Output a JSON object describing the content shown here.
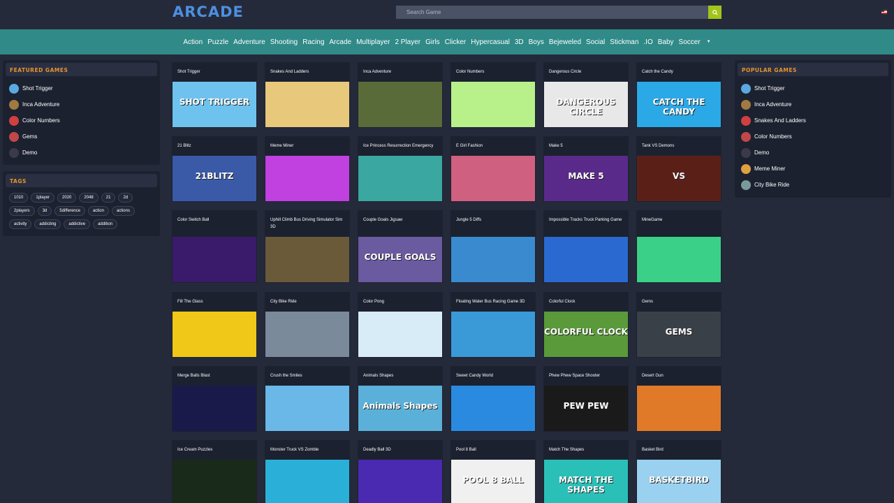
{
  "header": {
    "logo": "ARCADE",
    "search_placeholder": "Search Game"
  },
  "nav": {
    "items": [
      "Action",
      "Puzzle",
      "Adventure",
      "Shooting",
      "Racing",
      "Arcade",
      "Multiplayer",
      "2 Player",
      "Girls",
      "Clicker",
      "Hypercasual",
      "3D",
      "Boys",
      "Bejeweled",
      "Social",
      "Stickman",
      ".IO",
      "Baby",
      "Soccer"
    ]
  },
  "featured": {
    "title": "FEATURED GAMES",
    "items": [
      "Shot Trigger",
      "Inca Adventure",
      "Color Numbers",
      "Gems",
      "Demo"
    ]
  },
  "tags": {
    "title": "TAGS",
    "items": [
      "1010",
      "1player",
      "2020",
      "2048",
      "21",
      "2d",
      "2players",
      "3d",
      "5difference",
      "action",
      "actions",
      "activity",
      "addicting",
      "addictive",
      "addition"
    ]
  },
  "popular": {
    "title": "POPULAR GAMES",
    "items": [
      "Shot Trigger",
      "Inca Adventure",
      "Snakes And Ladders",
      "Color Numbers",
      "Demo",
      "Meme Miner",
      "City Bike Ride"
    ]
  },
  "games": [
    {
      "title": "Shot Trigger",
      "thumb_text": "SHOT TRIGGER",
      "bg": "#6ec3ee"
    },
    {
      "title": "Snakes And Ladders",
      "thumb_text": "",
      "bg": "#e8c87a"
    },
    {
      "title": "Inca Adventure",
      "thumb_text": "",
      "bg": "#5a6b3a"
    },
    {
      "title": "Color Numbers",
      "thumb_text": "",
      "bg": "#b8f08a"
    },
    {
      "title": "Dangerous Circle",
      "thumb_text": "DANGEROUS CIRCLE",
      "bg": "#e8e8e8"
    },
    {
      "title": "Catch the Candy",
      "thumb_text": "CATCH THE CANDY",
      "bg": "#2ba8e6"
    },
    {
      "title": "21 Blitz",
      "thumb_text": "21BLITZ",
      "bg": "#3a5aa8"
    },
    {
      "title": "Meme Miner",
      "thumb_text": "",
      "bg": "#c040e0"
    },
    {
      "title": "Ice Princess Resurrection Emergency",
      "thumb_text": "",
      "bg": "#3aa8a0"
    },
    {
      "title": "E Girl Fashion",
      "thumb_text": "",
      "bg": "#d06080"
    },
    {
      "title": "Make 5",
      "thumb_text": "MAKE 5",
      "bg": "#5a2a8a"
    },
    {
      "title": "Tank VS Demons",
      "thumb_text": "VS",
      "bg": "#5a2018"
    },
    {
      "title": "Color Switch Ball",
      "thumb_text": "",
      "bg": "#3a1a6a"
    },
    {
      "title": "Uphill Climb Bus Driving Simulator Sim 3D",
      "thumb_text": "",
      "bg": "#6a5a3a"
    },
    {
      "title": "Couple Goals Jigsaw",
      "thumb_text": "COUPLE GOALS",
      "bg": "#6a5aa0"
    },
    {
      "title": "Jungle 5 Diffs",
      "thumb_text": "",
      "bg": "#3a8ad0"
    },
    {
      "title": "Impossible Tracks Truck Parking Game",
      "thumb_text": "",
      "bg": "#2a6ad0"
    },
    {
      "title": "MineGame",
      "thumb_text": "",
      "bg": "#3ad088"
    },
    {
      "title": "Fill The Glass",
      "thumb_text": "",
      "bg": "#f0c818"
    },
    {
      "title": "City Bike Ride",
      "thumb_text": "",
      "bg": "#7a8a9a"
    },
    {
      "title": "Color Pong",
      "thumb_text": "",
      "bg": "#d8ecf8"
    },
    {
      "title": "Floating Water Bus Racing Game 3D",
      "thumb_text": "",
      "bg": "#3a9ad8"
    },
    {
      "title": "Colorful Clock",
      "thumb_text": "COLORFUL CLOCK",
      "bg": "#5a9a3a"
    },
    {
      "title": "Gems",
      "thumb_text": "GEMS",
      "bg": "#3a4048"
    },
    {
      "title": "Merge Balls Blast",
      "thumb_text": "",
      "bg": "#1a1a4a"
    },
    {
      "title": "Crush the Smiles",
      "thumb_text": "",
      "bg": "#6ab8e8"
    },
    {
      "title": "Animals Shapes",
      "thumb_text": "Animals Shapes",
      "bg": "#5ab0d8"
    },
    {
      "title": "Sweet Candy World",
      "thumb_text": "",
      "bg": "#2a8ae0"
    },
    {
      "title": "Phew Phew Space Shooter",
      "thumb_text": "PEW PEW",
      "bg": "#1a1a1a"
    },
    {
      "title": "Desert Gun",
      "thumb_text": "",
      "bg": "#e07a28"
    },
    {
      "title": "Ice Cream Puzzles",
      "thumb_text": "",
      "bg": "#1a2a1a"
    },
    {
      "title": "Monster Truck VS Zomble",
      "thumb_text": "",
      "bg": "#2ab0d8"
    },
    {
      "title": "Deadly Ball 3D",
      "thumb_text": "",
      "bg": "#4a2ab0"
    },
    {
      "title": "Pool 8 Ball",
      "thumb_text": "POOL 8 BALL",
      "bg": "#f0f0f0"
    },
    {
      "title": "Match The Shapes",
      "thumb_text": "MATCH THE SHAPES",
      "bg": "#2ac0b8"
    },
    {
      "title": "Basket Bird",
      "thumb_text": "BASKETBIRD",
      "bg": "#9ad0f0"
    }
  ],
  "colors": {
    "background": "#252a3a",
    "nav": "#2f8a88",
    "accent": "#e8922e",
    "logo": "#4d8fe0",
    "search_button": "#a3c51a"
  },
  "icons": {
    "search_button": "search-icon",
    "nav_more": "chevron-down-icon",
    "language": "us-flag-icon"
  }
}
